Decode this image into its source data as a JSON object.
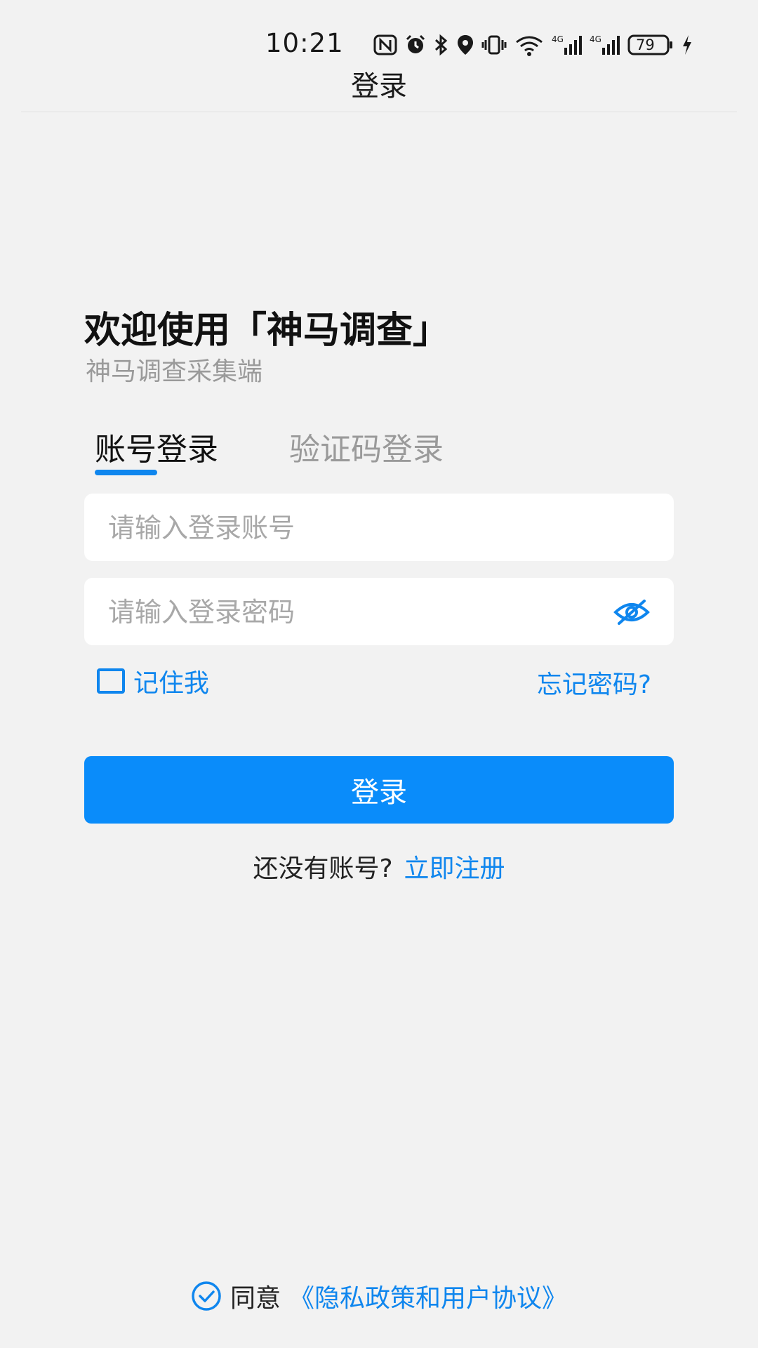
{
  "status_bar": {
    "time": "10:21",
    "battery": "79",
    "icons": [
      "nfc-icon",
      "alarm-icon",
      "bluetooth-icon",
      "location-icon",
      "vibrate-icon",
      "wifi-icon",
      "signal-4g-icon",
      "signal-4g-icon",
      "battery-icon",
      "charging-icon"
    ]
  },
  "title_bar": {
    "title": "登录"
  },
  "welcome": {
    "title": "欢迎使用「神马调查」",
    "subtitle": "神马调查采集端"
  },
  "tabs": [
    {
      "label": "账号登录",
      "active": true
    },
    {
      "label": "验证码登录",
      "active": false
    }
  ],
  "form": {
    "account_placeholder": "请输入登录账号",
    "account_value": "",
    "password_placeholder": "请输入登录密码",
    "password_value": "",
    "remember_label": "记住我",
    "remember_checked": false,
    "forgot_label": "忘记密码?"
  },
  "login_button": {
    "label": "登录"
  },
  "register": {
    "prompt": "还没有账号?",
    "link": "立即注册"
  },
  "agreement": {
    "prefix": "同意",
    "link": "《隐私政策和用户协议》"
  },
  "colors": {
    "accent": "#0f86ee",
    "button": "#0a8cfa",
    "background": "#f2f2f2",
    "muted": "#9a9a9a"
  }
}
